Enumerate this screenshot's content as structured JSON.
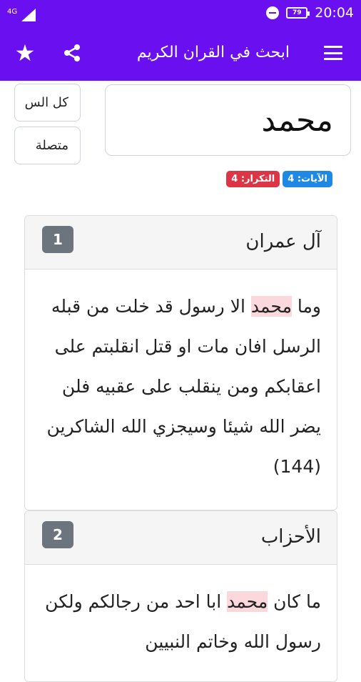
{
  "status_bar": {
    "network": "4G",
    "battery": "79",
    "time": "20:04"
  },
  "app_bar": {
    "title": "ابحث في القران الكريم",
    "icons": [
      "star-icon",
      "share-icon",
      "menu-icon"
    ]
  },
  "search": {
    "query": "محمد",
    "option_all": "كل الس",
    "option_connected": "متصلة"
  },
  "stats": {
    "verses": "الآيات: 4",
    "repeats": "التكرار: 4"
  },
  "results": [
    {
      "index": "1",
      "surah": "آل عمران",
      "verse_before": "وما ",
      "verse_match": "محمد",
      "verse_after": " الا رسول قد خلت من قبله الرسل افان مات او قتل انقلبتم على اعقابكم ومن ينقلب على عقبيه فلن يضر الله شيئا وسيجزي الله الشاكرين (144)"
    },
    {
      "index": "2",
      "surah": "الأحزاب",
      "verse_before": "ما كان ",
      "verse_match": "محمد",
      "verse_after": " ابا احد من رجالكم ولكن رسول الله وخاتم النبيين"
    }
  ],
  "colors": {
    "primary": "#6a0ff0",
    "highlight": "#fbd8dc",
    "badge_blue": "#1e88e5",
    "badge_red": "#dc3545",
    "index_badge": "#6c757d"
  }
}
